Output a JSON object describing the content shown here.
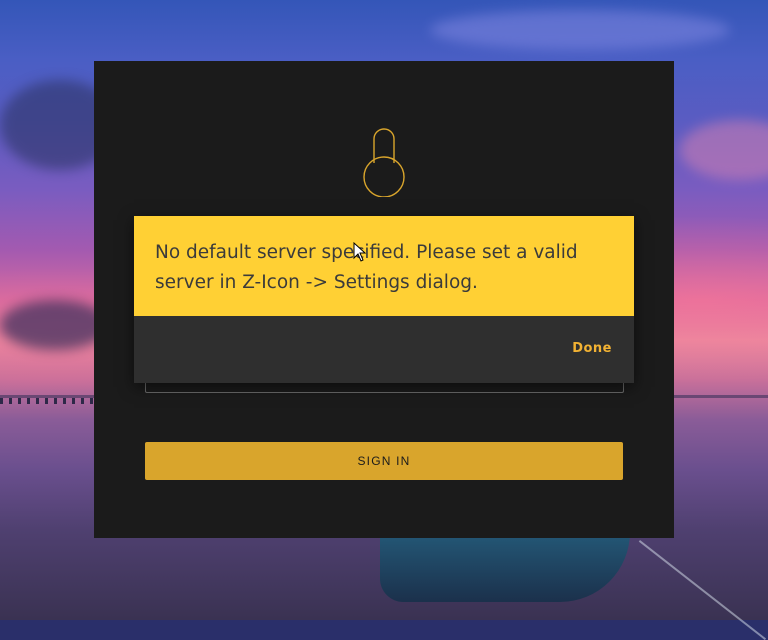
{
  "login": {
    "signin_label": "SIGN IN",
    "icon": "lock-icon"
  },
  "alert": {
    "message": "No default server specified. Please set a valid server in Z-Icon -> Settings dialog.",
    "done_label": "Done"
  },
  "colors": {
    "card_background": "#1b1b1b",
    "accent": "#d9a52c",
    "alert_background": "#ffd034",
    "alert_footer": "#2f2f2f",
    "done_text": "#f2b233"
  }
}
